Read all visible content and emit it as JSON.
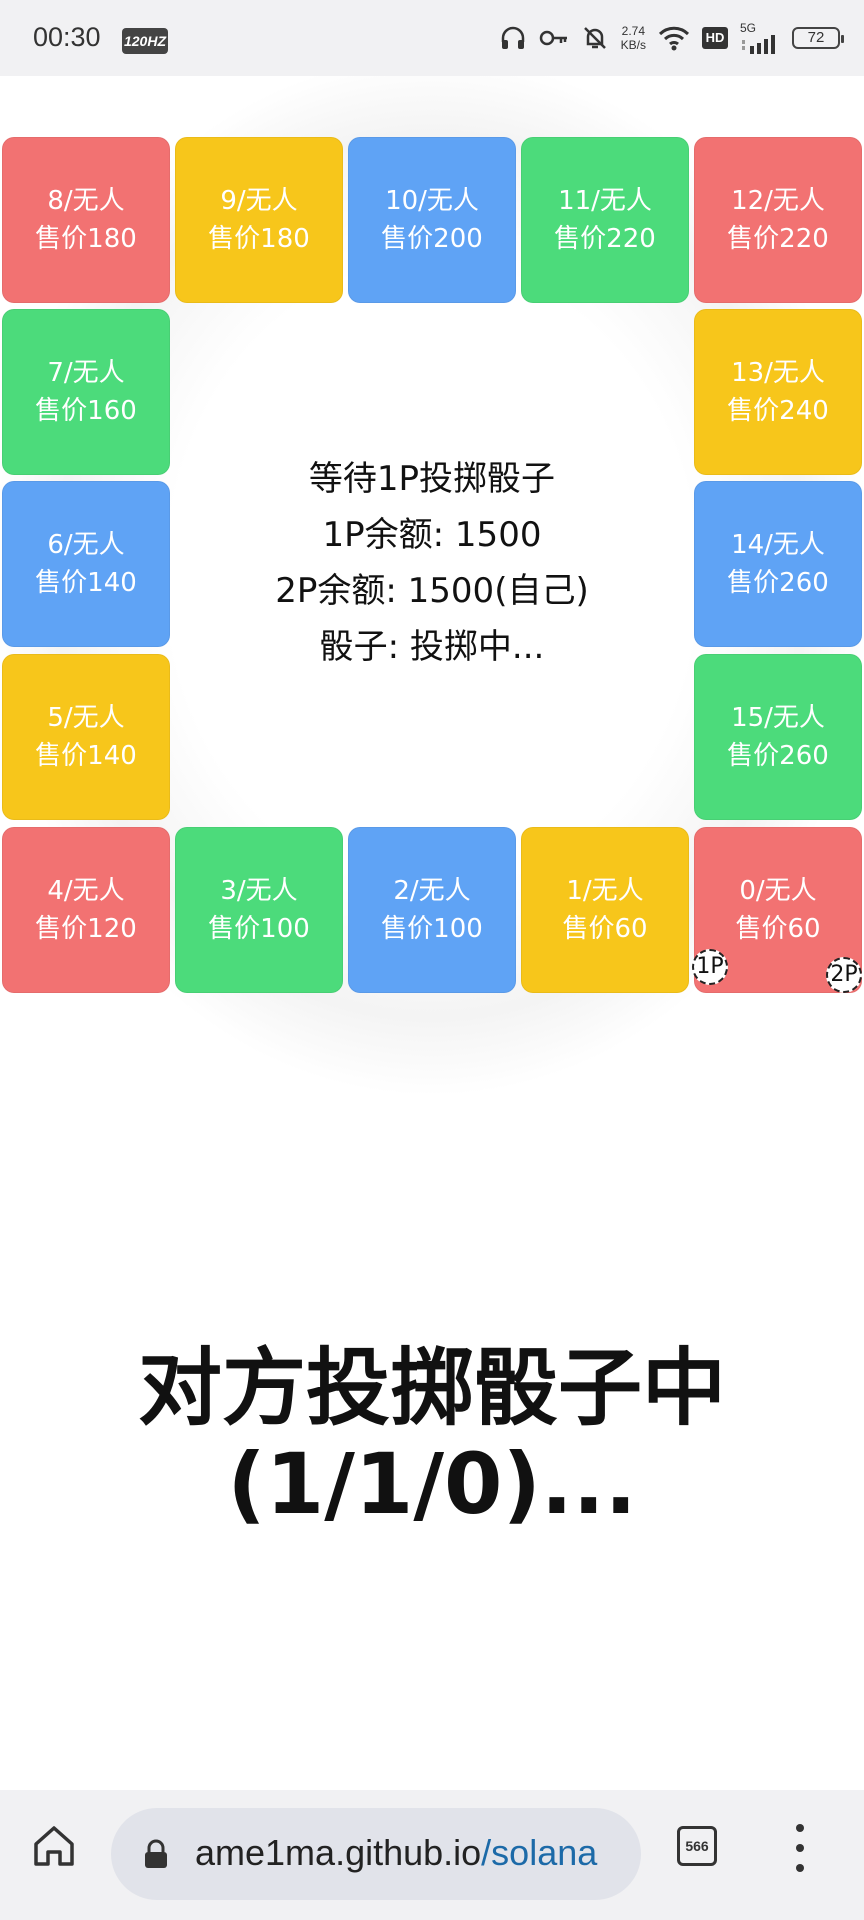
{
  "status_bar": {
    "time": "00:30",
    "refresh_badge": "120HZ",
    "net_speed_value": "2.74",
    "net_speed_unit": "KB/s",
    "hd_label": "HD",
    "network_label": "5G",
    "battery": "72"
  },
  "board": {
    "cells": [
      {
        "label": "8/无人",
        "price": "售价180",
        "color": "red"
      },
      {
        "label": "9/无人",
        "price": "售价180",
        "color": "yellow"
      },
      {
        "label": "10/无人",
        "price": "售价200",
        "color": "blue"
      },
      {
        "label": "11/无人",
        "price": "售价220",
        "color": "green"
      },
      {
        "label": "12/无人",
        "price": "售价220",
        "color": "red"
      },
      {
        "label": "7/无人",
        "price": "售价160",
        "color": "green"
      },
      {
        "label": "13/无人",
        "price": "售价240",
        "color": "yellow"
      },
      {
        "label": "6/无人",
        "price": "售价140",
        "color": "blue"
      },
      {
        "label": "14/无人",
        "price": "售价260",
        "color": "blue"
      },
      {
        "label": "5/无人",
        "price": "售价140",
        "color": "yellow"
      },
      {
        "label": "15/无人",
        "price": "售价260",
        "color": "green"
      },
      {
        "label": "4/无人",
        "price": "售价120",
        "color": "red"
      },
      {
        "label": "3/无人",
        "price": "售价100",
        "color": "green"
      },
      {
        "label": "2/无人",
        "price": "售价100",
        "color": "blue"
      },
      {
        "label": "1/无人",
        "price": "售价60",
        "color": "yellow"
      },
      {
        "label": "0/无人",
        "price": "售价60",
        "color": "red"
      }
    ],
    "tokens": {
      "p1": "1P",
      "p2": "2P"
    },
    "center": {
      "line1": "等待1P投掷骰子",
      "line2": "1P余额: 1500",
      "line3": "2P余额: 1500(自己)",
      "line4": "骰子: 投掷中..."
    }
  },
  "message": {
    "line1": "对方投掷骰子中",
    "line2": "(1/1/0)..."
  },
  "browser": {
    "url_host": "ame1ma.github.io",
    "url_path": "/solana",
    "tab_count": "566"
  },
  "colors": {
    "red": "#f27272",
    "yellow": "#f7c61b",
    "blue": "#5fa3f5",
    "green": "#4cdb7b"
  }
}
